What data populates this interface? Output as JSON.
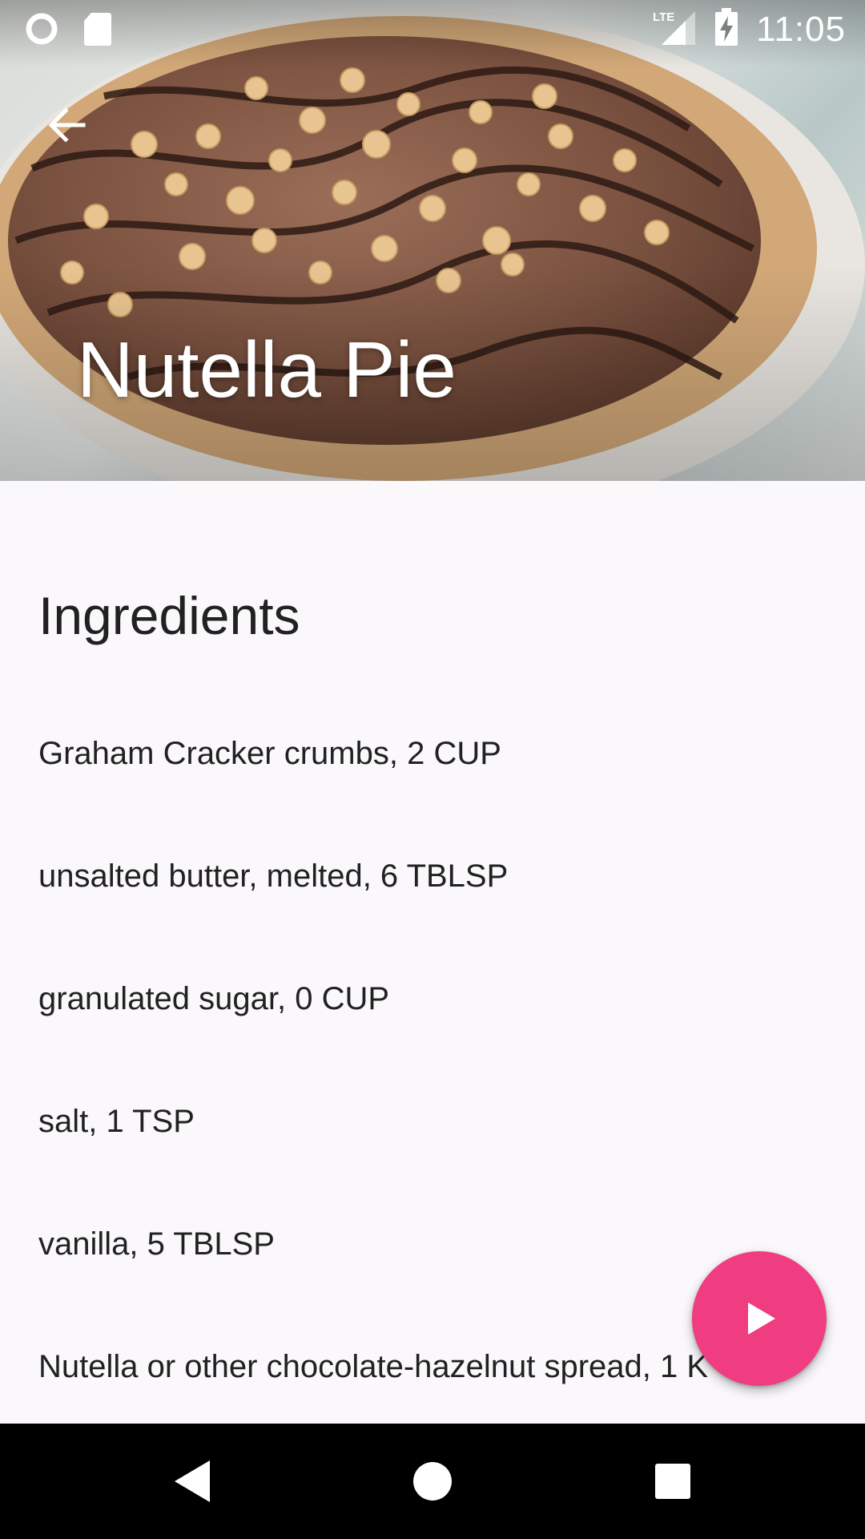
{
  "status_bar": {
    "time": "11:05",
    "network_label": "LTE",
    "left_icons": [
      "circle-notification-icon",
      "sd-card-icon"
    ],
    "right_icons": [
      "lte-signal-icon",
      "battery-charging-icon"
    ]
  },
  "app_bar": {
    "back_icon": "arrow-back-icon",
    "title": "Nutella Pie"
  },
  "content": {
    "section_heading": "Ingredients",
    "ingredients": [
      "Graham Cracker crumbs, 2 CUP",
      "unsalted butter, melted, 6 TBLSP",
      "granulated sugar, 0 CUP",
      "salt, 1 TSP",
      "vanilla, 5 TBLSP",
      "Nutella or other chocolate-hazelnut spread, 1 K"
    ]
  },
  "fab": {
    "icon": "play-icon",
    "color": "#F03C80"
  },
  "nav_bar": {
    "buttons": [
      "back-triangle-icon",
      "home-circle-icon",
      "recents-square-icon"
    ]
  },
  "colors": {
    "background": "#FAF8FB",
    "text_primary": "#212121",
    "accent": "#F03C80"
  }
}
